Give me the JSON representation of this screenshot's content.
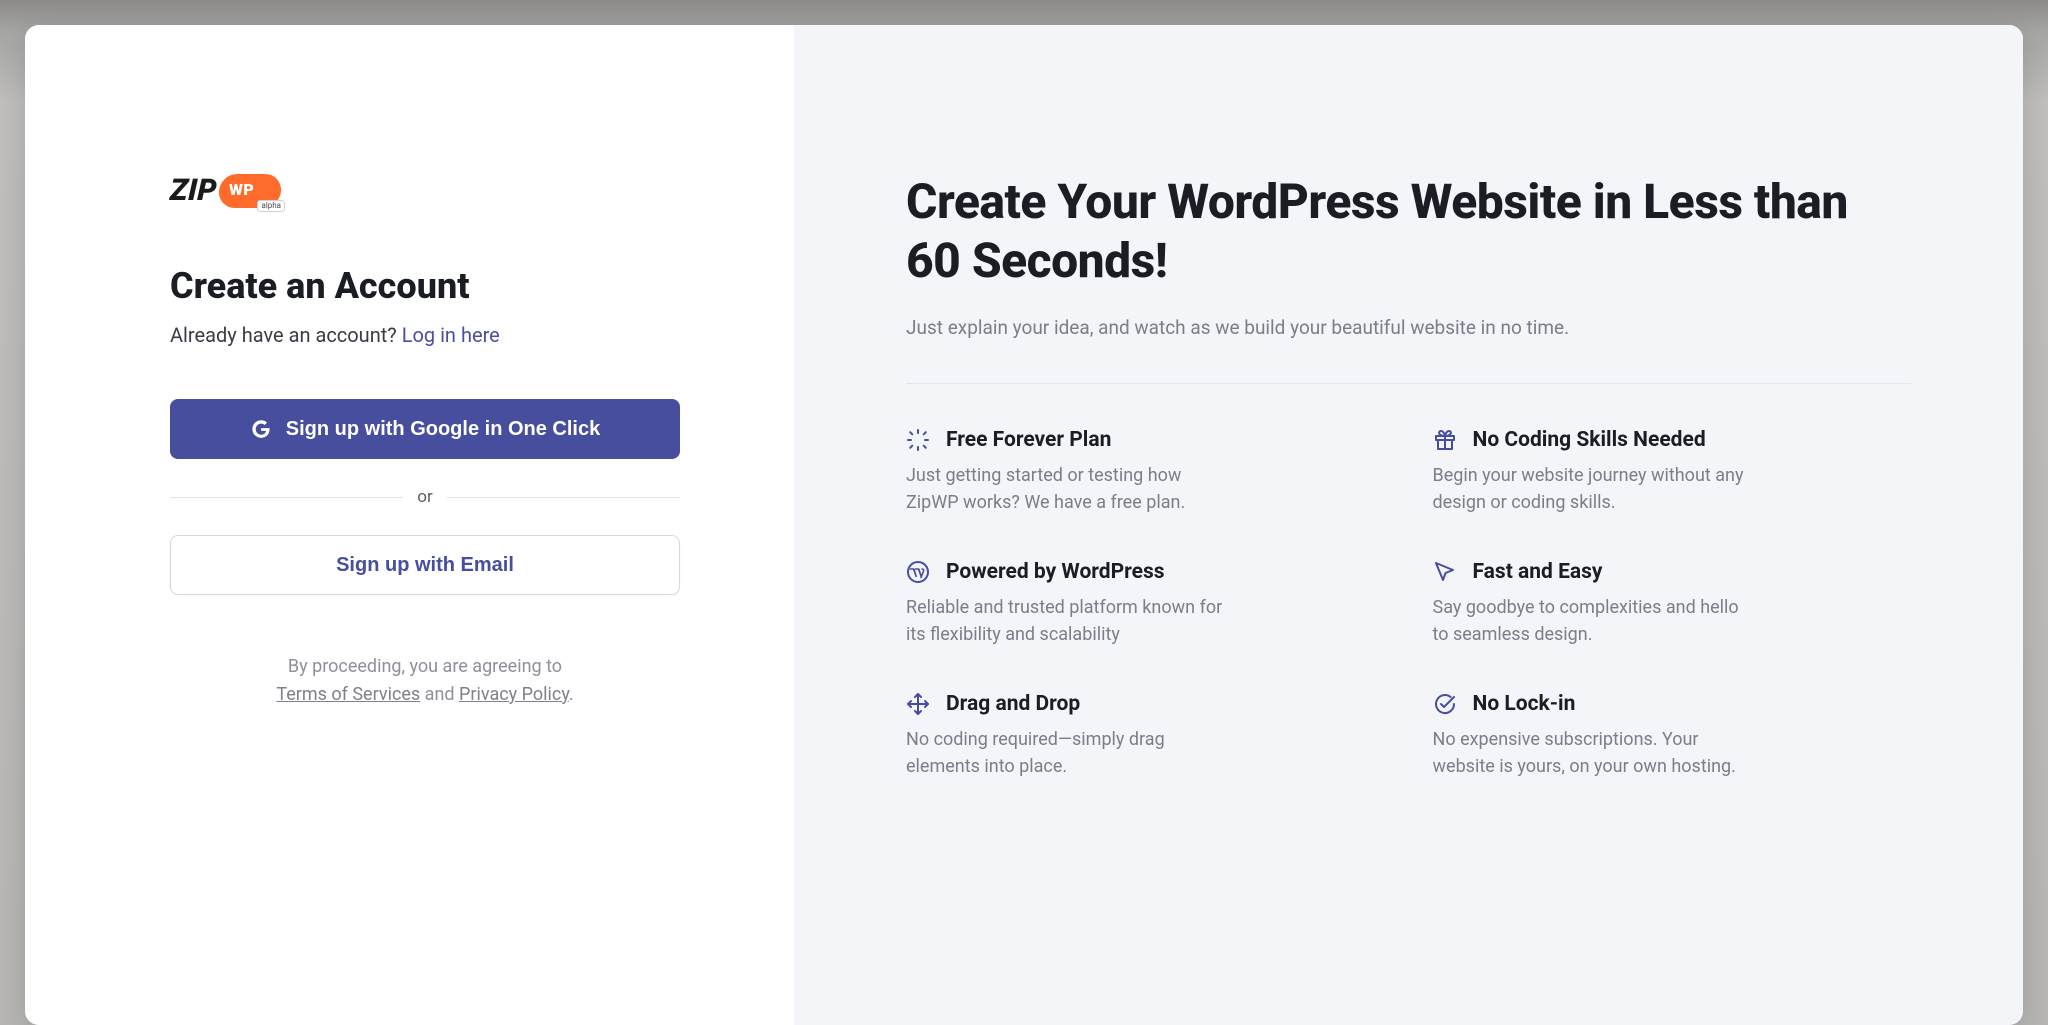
{
  "logo": {
    "text": "ZIP",
    "pill": "WP",
    "badge": "alpha"
  },
  "left": {
    "heading": "Create an Account",
    "already_text": "Already have an account? ",
    "login_link": "Log in here",
    "google_button": "Sign up with Google in One Click",
    "or_label": "or",
    "email_button": "Sign up with Email",
    "legal_prefix": "By proceeding, you are agreeing to",
    "terms_label": "Terms of Services",
    "legal_and": " and ",
    "privacy_label": "Privacy Policy",
    "legal_suffix": "."
  },
  "right": {
    "title": "Create Your WordPress Website in Less than 60 Seconds!",
    "subtitle": "Just explain your idea, and watch as we build your beautiful website in no time.",
    "features": [
      {
        "icon": "sparkle-icon",
        "title": "Free Forever Plan",
        "desc": "Just getting started or testing how ZipWP works? We have a free plan."
      },
      {
        "icon": "gift-icon",
        "title": "No Coding Skills Needed",
        "desc": "Begin your website journey without any design or coding skills."
      },
      {
        "icon": "wordpress-icon",
        "title": "Powered by WordPress",
        "desc": "Reliable and trusted platform known for its flexibility and scalability"
      },
      {
        "icon": "pointer-icon",
        "title": "Fast and Easy",
        "desc": "Say goodbye to complexities and hello to seamless design."
      },
      {
        "icon": "move-icon",
        "title": "Drag and Drop",
        "desc": "No coding required—simply drag elements into place."
      },
      {
        "icon": "check-icon",
        "title": "No Lock-in",
        "desc": "No expensive subscriptions. Your website is yours, on your own hosting."
      }
    ]
  }
}
